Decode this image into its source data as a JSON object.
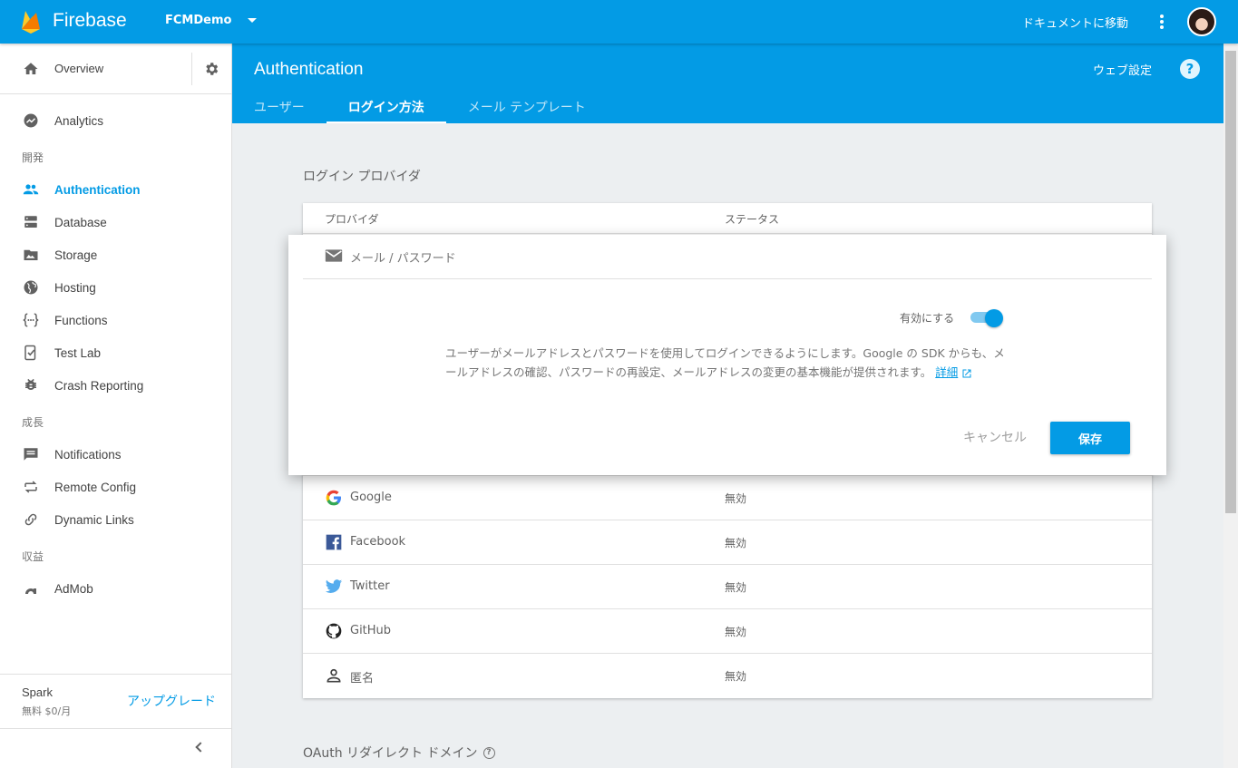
{
  "topbar": {
    "brand": "Firebase",
    "project": "FCMDemo",
    "docs_link": "ドキュメントに移動"
  },
  "sidebar": {
    "overview": "Overview",
    "items": [
      {
        "label": "Analytics",
        "icon": "analytics-icon"
      },
      {
        "section": "開発"
      },
      {
        "label": "Authentication",
        "icon": "people-icon",
        "active": true
      },
      {
        "label": "Database",
        "icon": "database-icon"
      },
      {
        "label": "Storage",
        "icon": "image-icon"
      },
      {
        "label": "Hosting",
        "icon": "globe-icon"
      },
      {
        "label": "Functions",
        "icon": "functions-icon"
      },
      {
        "label": "Test Lab",
        "icon": "testlab-icon"
      },
      {
        "label": "Crash Reporting",
        "icon": "bug-icon"
      },
      {
        "section": "成長"
      },
      {
        "label": "Notifications",
        "icon": "message-icon"
      },
      {
        "label": "Remote Config",
        "icon": "remote-config-icon"
      },
      {
        "label": "Dynamic Links",
        "icon": "link-icon"
      },
      {
        "section": "収益"
      },
      {
        "label": "AdMob",
        "icon": "admob-icon"
      }
    ],
    "section_dev": "開発",
    "section_grow": "成長",
    "section_earn": "収益",
    "plan_name": "Spark",
    "plan_price": "無料 $0/月",
    "upgrade": "アップグレード"
  },
  "header": {
    "title": "Authentication",
    "web_setup": "ウェブ設定",
    "help": "?",
    "tabs": [
      "ユーザー",
      "ログイン方法",
      "メール テンプレート"
    ]
  },
  "providers": {
    "section_title": "ログイン プロバイダ",
    "col_provider": "プロバイダ",
    "col_status": "ステータス",
    "expanded": {
      "name": "メール / パスワード",
      "toggle_label": "有効にする",
      "enabled": true,
      "description": "ユーザーがメールアドレスとパスワードを使用してログインできるようにします。Google の SDK からも、メールアドレスの確認、パスワードの再設定、メールアドレスの変更の基本機能が提供されます。",
      "more_link": "詳細",
      "cancel": "キャンセル",
      "save": "保存"
    },
    "rows": [
      {
        "name": "Google",
        "status": "無効"
      },
      {
        "name": "Facebook",
        "status": "無効"
      },
      {
        "name": "Twitter",
        "status": "無効"
      },
      {
        "name": "GitHub",
        "status": "無効"
      },
      {
        "name": "匿名",
        "status": "無効"
      }
    ]
  },
  "oauth": {
    "title": "OAuth リダイレクト ドメイン"
  },
  "colors": {
    "accent": "#039be5",
    "sidebar_bg": "#ffffff",
    "content_bg": "#eceff1"
  }
}
